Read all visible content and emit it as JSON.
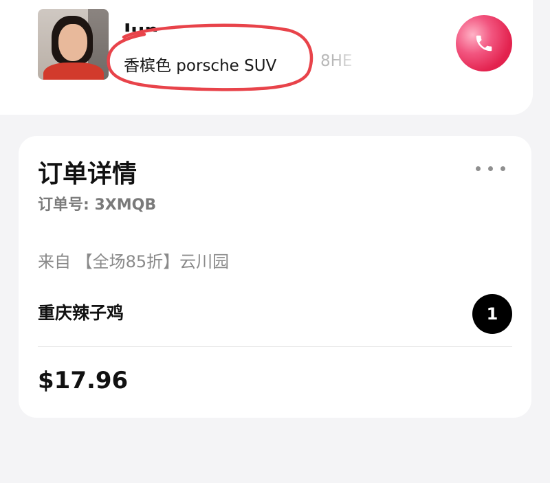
{
  "driver": {
    "name": "Jun",
    "car": "香槟色 porsche SUV",
    "plate": "8HE",
    "call_icon": "phone-icon",
    "accent_color": "#e3234f",
    "annotation_color": "#e8434a"
  },
  "order": {
    "title": "订单详情",
    "number_label": "订单号: 3XMQB",
    "from_line": "来自 【全场85折】云川园",
    "item_name": "重庆辣子鸡",
    "quantity": "1",
    "price": "$17.96",
    "more_icon": "more-horizontal-icon"
  }
}
